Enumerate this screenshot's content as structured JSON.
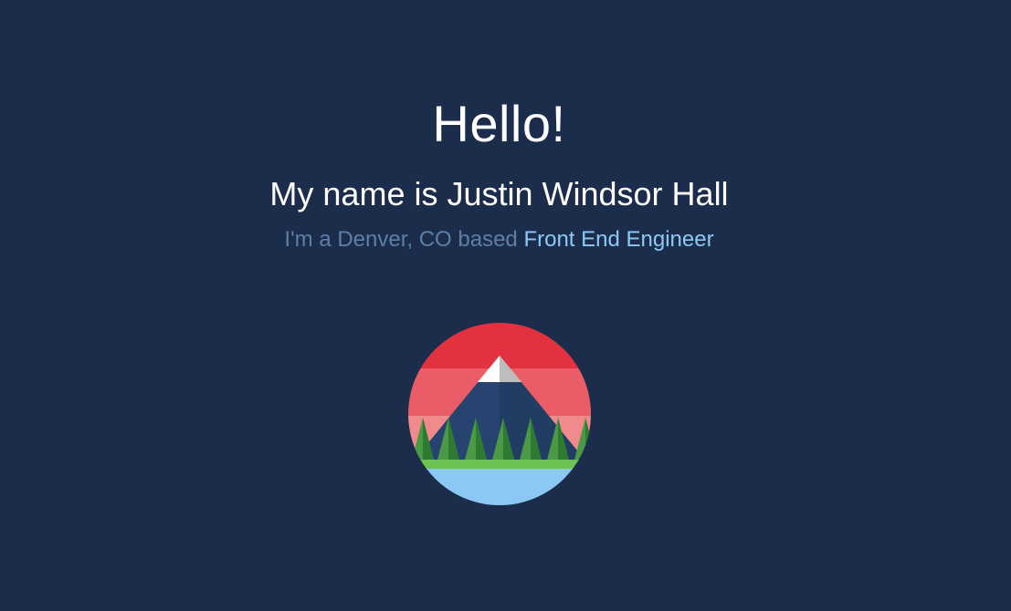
{
  "hero": {
    "greeting": "Hello!",
    "name_line": "My name is Justin Windsor Hall",
    "tagline_prefix": "I'm a Denver, CO based",
    "tagline_role": "Front End Engineer"
  },
  "logo": {
    "icon": "mountain-landscape-logo",
    "colors": {
      "sky_top": "#e2323f",
      "sky_mid": "#eb5d66",
      "sky_low": "#f08a8c",
      "mountain": "#26446f",
      "snow": "#ffffff",
      "snow_shade": "#bdbdbd",
      "trees_light": "#4a9a45",
      "trees_dark": "#2f7a33",
      "grass": "#6cc450",
      "water": "#8cc8f4"
    }
  },
  "colors": {
    "background": "#1c2d4b",
    "heading_text": "#ffffff",
    "muted_text": "#5d7fa8",
    "accent_text": "#8cc9f5"
  }
}
